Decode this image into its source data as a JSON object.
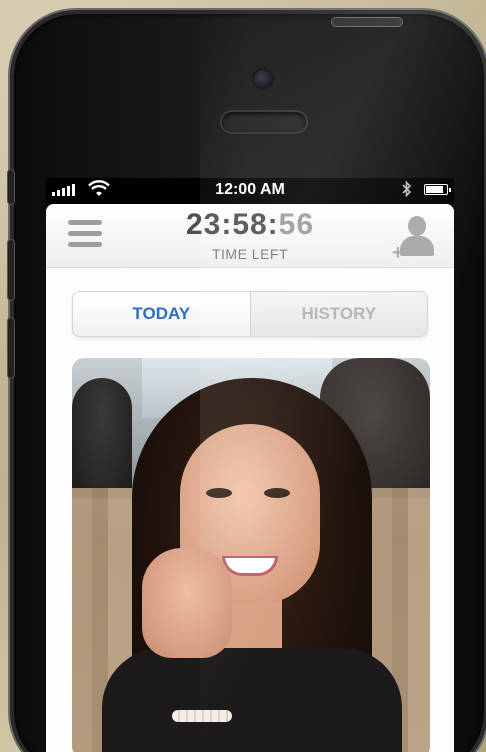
{
  "statusbar": {
    "time": "12:00 AM",
    "icons": [
      "signal-icon",
      "wifi-icon",
      "bluetooth-icon",
      "battery-icon"
    ]
  },
  "header": {
    "timer_main": "23:58:",
    "timer_seconds": "56",
    "timer_label": "TIME LEFT",
    "menu_icon": "hamburger-menu-icon",
    "add_user_icon": "add-user-icon"
  },
  "tabs": [
    {
      "label": "TODAY",
      "active": true
    },
    {
      "label": "HISTORY",
      "active": false
    }
  ],
  "photo": {
    "subject": "profile-photo"
  },
  "colors": {
    "accent": "#2a6fc4",
    "inactive_tab_text": "#b3b3b3",
    "timer_text": "#505050"
  }
}
